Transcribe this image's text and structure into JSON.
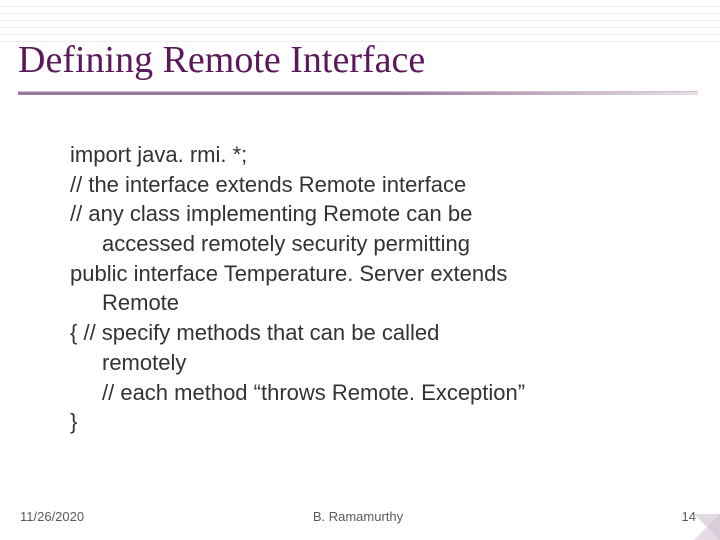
{
  "title": "Defining Remote Interface",
  "body": {
    "l1": "import java. rmi. *;",
    "l2": "// the interface extends Remote interface",
    "l3": "// any class implementing Remote can be",
    "l4": "accessed remotely security permitting",
    "l5": "public interface Temperature. Server extends",
    "l6": "Remote",
    "l7": "{  // specify methods that can be called",
    "l8": "remotely",
    "l9": "// each method “throws Remote. Exception”",
    "l10": "}"
  },
  "footer": {
    "date": "11/26/2020",
    "author": "B. Ramamurthy",
    "page": "14"
  }
}
